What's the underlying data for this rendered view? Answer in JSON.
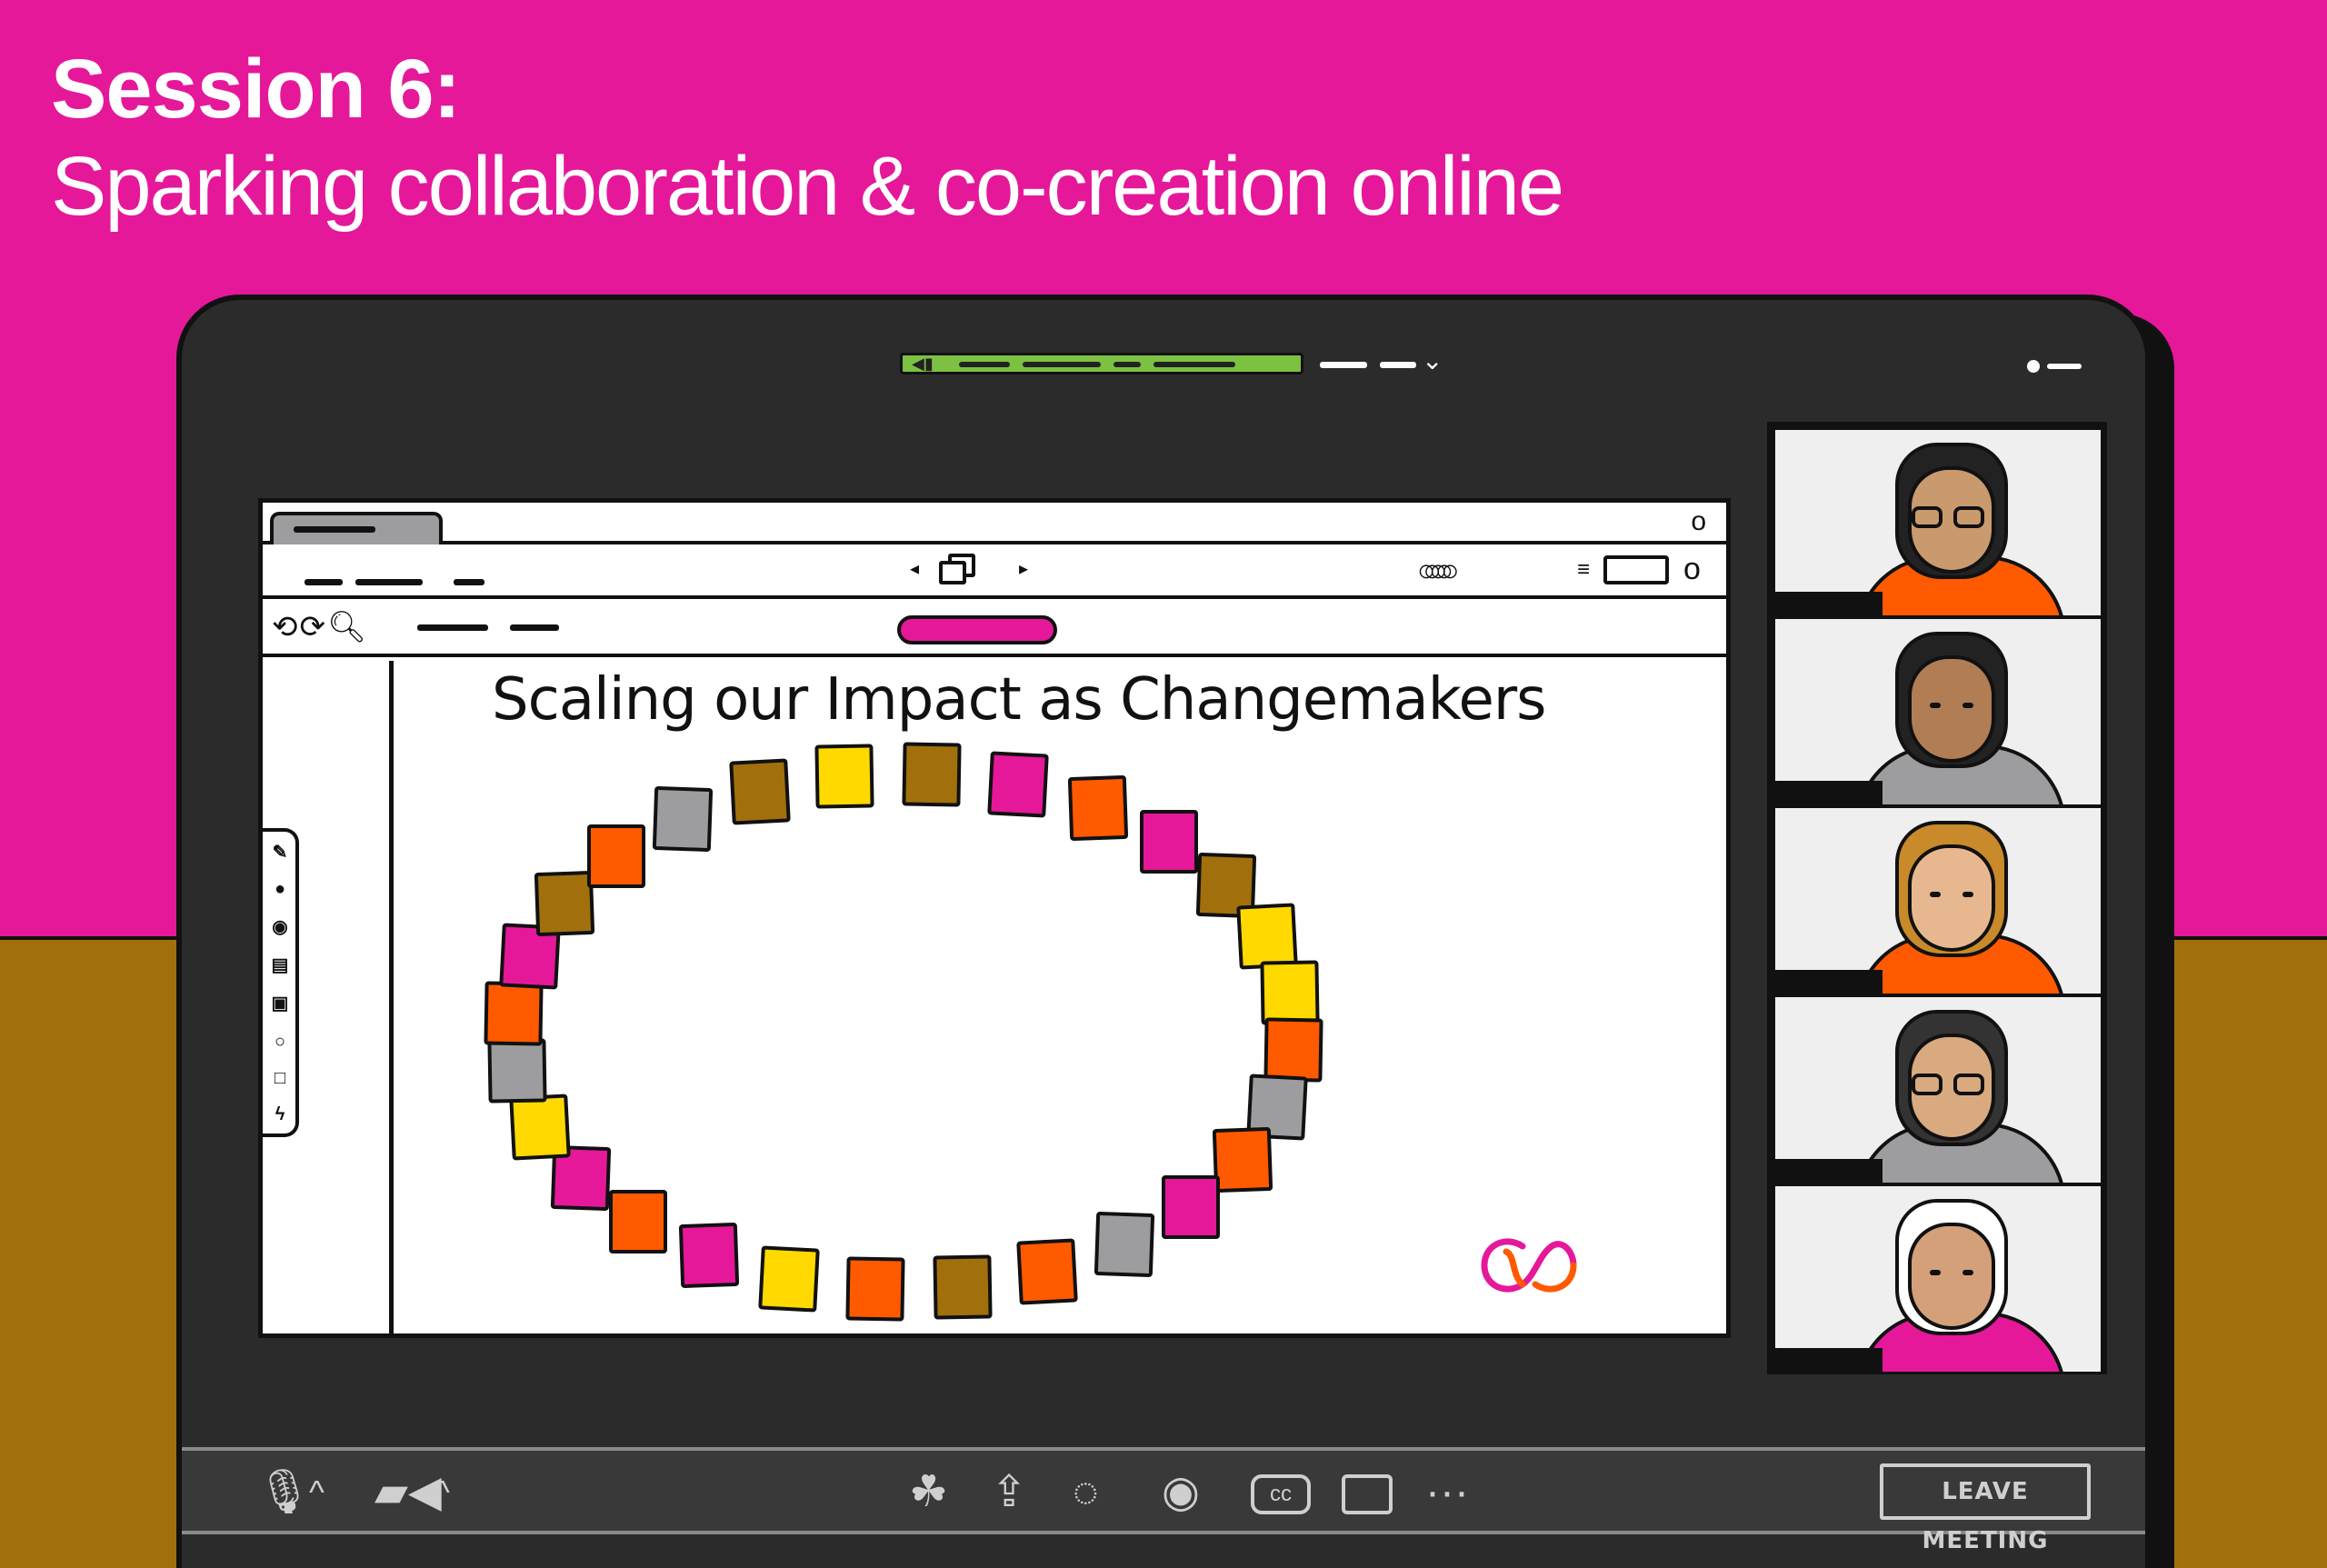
{
  "header": {
    "session": "Session 6:",
    "subtitle": "Sparking collaboration & co-creation online"
  },
  "meeting": {
    "board": {
      "title": "Scaling our Impact as Changemakers",
      "notes": [
        {
          "color": "#a1700c"
        },
        {
          "color": "#ffd900"
        },
        {
          "color": "#a1700c"
        },
        {
          "color": "#e5189a"
        },
        {
          "color": "#ff5a00"
        },
        {
          "color": "#e5189a"
        },
        {
          "color": "#a1700c"
        },
        {
          "color": "#ffd900"
        },
        {
          "color": "#ffd900"
        },
        {
          "color": "#ff5a00"
        },
        {
          "color": "#9d9d9f"
        },
        {
          "color": "#ff5a00"
        },
        {
          "color": "#e5189a"
        },
        {
          "color": "#9d9d9f"
        },
        {
          "color": "#ff5a00"
        },
        {
          "color": "#a1700c"
        },
        {
          "color": "#ff5a00"
        },
        {
          "color": "#ffd900"
        },
        {
          "color": "#e5189a"
        },
        {
          "color": "#ff5a00"
        },
        {
          "color": "#e5189a"
        },
        {
          "color": "#ffd900"
        },
        {
          "color": "#9d9d9f"
        },
        {
          "color": "#ff5a00"
        },
        {
          "color": "#e5189a"
        },
        {
          "color": "#a1700c"
        },
        {
          "color": "#ff5a00"
        },
        {
          "color": "#9d9d9f"
        }
      ]
    },
    "participants": [
      {
        "hair": "#222222",
        "skin": "#c99a6e",
        "shirt": "#ff5a00",
        "glasses": true
      },
      {
        "hair": "#222222",
        "skin": "#b07d55",
        "shirt": "#9d9d9f",
        "glasses": false
      },
      {
        "hair": "#c88a2a",
        "skin": "#e7b890",
        "shirt": "#ff5a00",
        "glasses": false
      },
      {
        "hair": "#333333",
        "skin": "#d9aa80",
        "shirt": "#9d9d9f",
        "glasses": true
      },
      {
        "hair": "#ffffff",
        "skin": "#d3a07a",
        "shirt": "#e5189a",
        "glasses": false
      }
    ],
    "controls": {
      "leave_label": "LEAVE MEETING"
    }
  },
  "colors": {
    "magenta": "#e5189a",
    "ochre": "#a1700c",
    "green": "#7cc142",
    "orange": "#ff5a00",
    "yellow": "#ffd900",
    "grey": "#9d9d9f",
    "laptop": "#2c2b2c"
  },
  "icons": {
    "mic": "microphone-icon",
    "camera": "video-camera-icon",
    "reactions": "reactions-icon",
    "share": "share-screen-icon",
    "chat": "chat-icon",
    "record": "record-icon",
    "captions": "closed-captions-icon",
    "cast": "cast-icon",
    "more": "more-options-icon"
  }
}
